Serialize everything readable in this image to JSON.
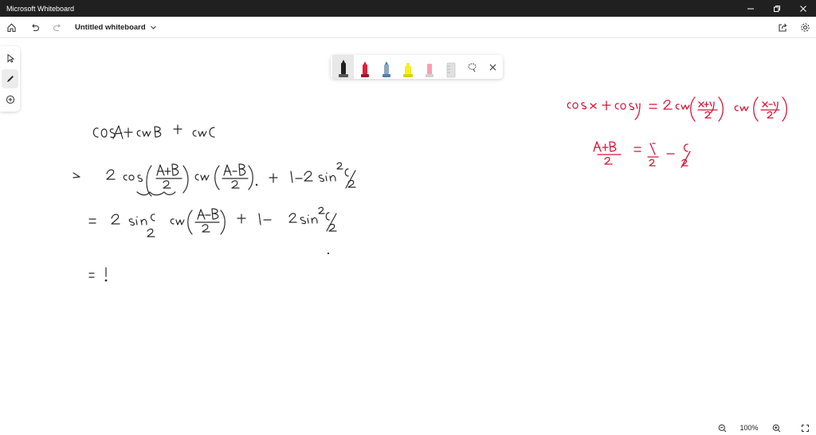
{
  "window": {
    "title": "Microsoft Whiteboard"
  },
  "appbar": {
    "board_title": "Untitled whiteboard"
  },
  "zoom": {
    "value": "100%"
  },
  "icons": {
    "home": "home-icon",
    "undo": "undo-icon",
    "redo": "redo-icon",
    "share": "share-icon",
    "settings": "gear-icon",
    "select": "pointer-icon",
    "ink": "pen-icon",
    "add": "plus-circle-icon",
    "lasso": "lasso-icon",
    "close": "close-icon",
    "zoom_out": "zoom-out-icon",
    "zoom_in": "zoom-in-icon",
    "fit": "fit-screen-icon"
  },
  "pens": [
    {
      "name": "black-pen",
      "color": "#202020"
    },
    {
      "name": "red-pen",
      "color": "#e0203a"
    },
    {
      "name": "blue-pen",
      "color": "#4a7fb0"
    },
    {
      "name": "highlighter-yellow",
      "color": "#f5f021"
    },
    {
      "name": "highlighter-pink",
      "color": "#f06a8a"
    },
    {
      "name": "ruler",
      "color": "#c8c8c8"
    }
  ],
  "ink": {
    "black_color": "#2a2a2a",
    "red_color": "#d8153a"
  }
}
